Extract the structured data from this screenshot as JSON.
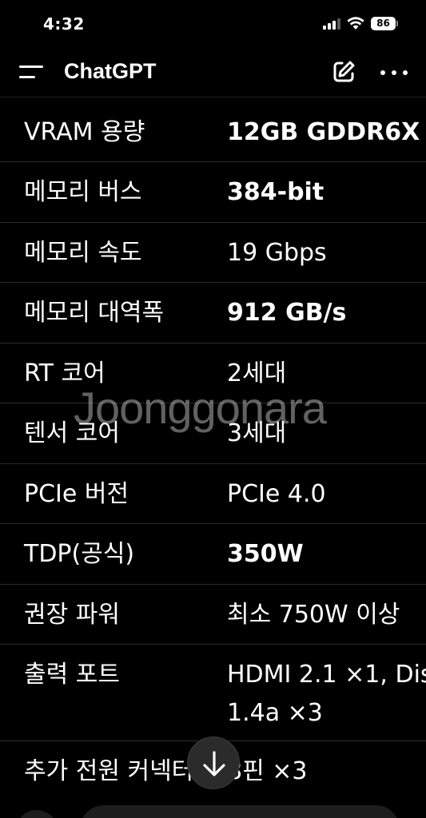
{
  "status_bar": {
    "time": "4:32",
    "battery": "86"
  },
  "header": {
    "title": "ChatGPT"
  },
  "watermark": "Joonggonara",
  "spec_rows": [
    {
      "label": "VRAM 용량",
      "value": "12GB GDDR6X",
      "bold": true
    },
    {
      "label": "메모리 버스",
      "value": "384-bit",
      "bold": true
    },
    {
      "label": "메모리 속도",
      "value": "19 Gbps",
      "bold": false
    },
    {
      "label": "메모리 대역폭",
      "value": "912 GB/s",
      "bold": true
    },
    {
      "label": "RT 코어",
      "value": "2세대",
      "bold": false
    },
    {
      "label": "텐서 코어",
      "value": "3세대",
      "bold": false
    },
    {
      "label": "PCIe 버전",
      "value": "PCIe 4.0",
      "bold": false
    },
    {
      "label": "TDP(공식)",
      "value": "350W",
      "bold": true
    },
    {
      "label": "권장 파워",
      "value": "최소 750W 이상",
      "bold": false
    },
    {
      "label": "출력 포트",
      "value_line1": "HDMI 2.1 ×1, Dis",
      "value_line2": "1.4a ×3",
      "bold": false
    },
    {
      "label": "추가 전원 커넥터",
      "value": "8핀 ×3",
      "bold": false
    }
  ]
}
